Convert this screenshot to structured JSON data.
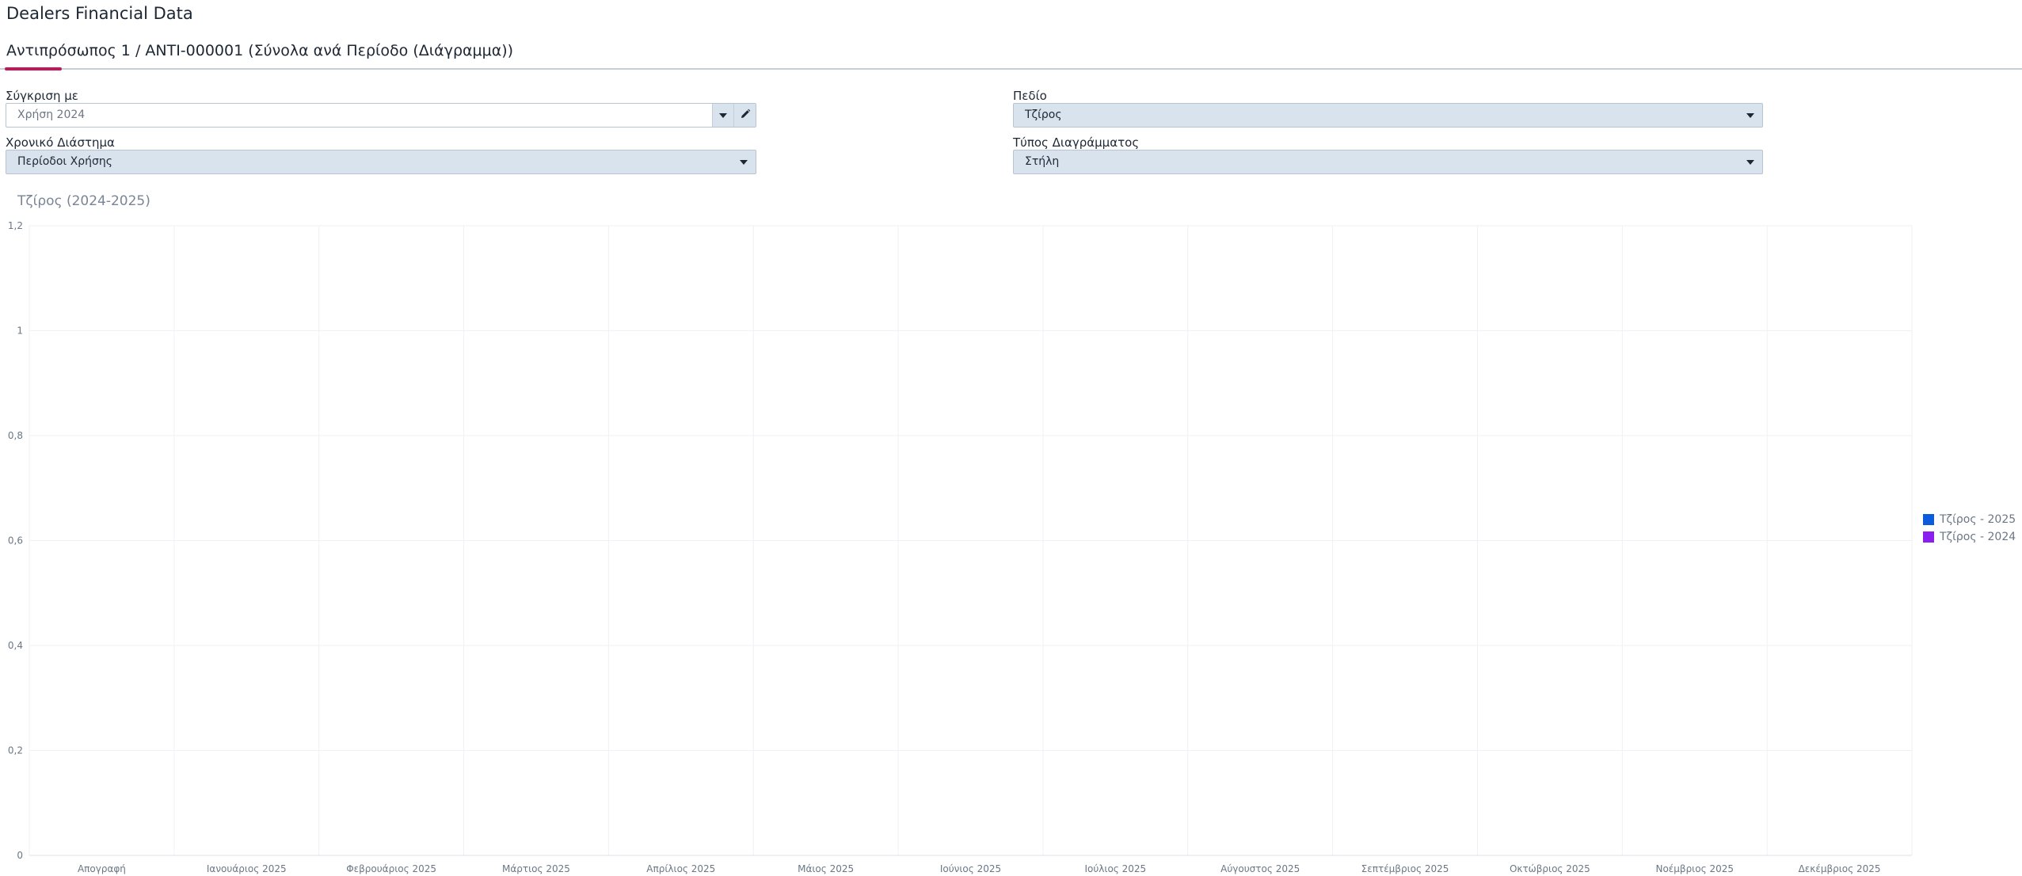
{
  "header": {
    "title": "Dealers Financial Data"
  },
  "tabs": [
    {
      "label": "Αντιπρόσωπος 1 / ANTI-000001 (Σύνολα ανά Περίοδο (Διάγραμμα))",
      "active": true
    }
  ],
  "filters": {
    "compare": {
      "label": "Σύγκριση με",
      "value": "Χρήση 2024"
    },
    "field": {
      "label": "Πεδίο",
      "value": "Τζίρος"
    },
    "period": {
      "label": "Χρονικό Διάστημα",
      "value": "Περίοδοι Χρήσης"
    },
    "chart_type": {
      "label": "Τύπος Διαγράμματος",
      "value": "Στήλη"
    }
  },
  "colors": {
    "accent": "#c2185b",
    "series_2025": "#0b5bdb",
    "series_2024": "#8a1ff0"
  },
  "chart_data": {
    "type": "bar",
    "title": "Τζίρος (2024-2025)",
    "xlabel": "",
    "ylabel": "",
    "categories": [
      "Απογραφή",
      "Ιανουάριος 2025",
      "Φεβρουάριος 2025",
      "Μάρτιος 2025",
      "Απρίλιος 2025",
      "Μάιος 2025",
      "Ιούνιος 2025",
      "Ιούλιος 2025",
      "Αύγουστος 2025",
      "Σεπτέμβριος 2025",
      "Οκτώβριος 2025",
      "Νοέμβριος 2025",
      "Δεκέμβριος 2025"
    ],
    "series": [
      {
        "name": "Τζίρος - 2025",
        "color": "#0b5bdb",
        "values": [
          0,
          0,
          0,
          0,
          0,
          0,
          0,
          0,
          0,
          0,
          0,
          0,
          0
        ]
      },
      {
        "name": "Τζίρος - 2024",
        "color": "#8a1ff0",
        "values": [
          0,
          0,
          0,
          0,
          0,
          0,
          0,
          0,
          0,
          0,
          0,
          0,
          0
        ]
      }
    ],
    "ylim": [
      0,
      1.2
    ],
    "yticks": [
      "0",
      "0,2",
      "0,4",
      "0,6",
      "0,8",
      "1",
      "1,2"
    ],
    "grid": true,
    "legend": "right"
  }
}
